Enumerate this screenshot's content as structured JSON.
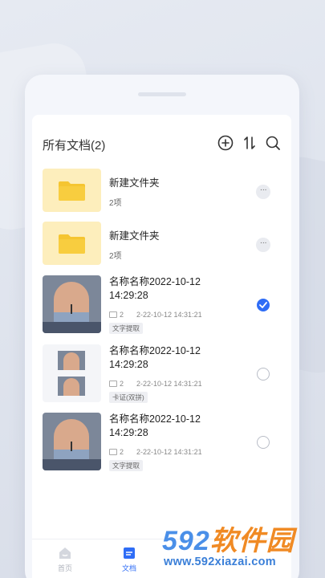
{
  "header": {
    "title": "所有文档(2)",
    "icons": [
      "add-circle-icon",
      "sort-icon",
      "search-icon"
    ]
  },
  "items": [
    {
      "type": "folder",
      "title": "新建文件夹",
      "subtitle": "2项",
      "action": "more"
    },
    {
      "type": "folder",
      "title": "新建文件夹",
      "subtitle": "2项",
      "action": "more"
    },
    {
      "type": "document",
      "title": "名称名称2022-10-12 14:29:28",
      "count": "2",
      "date": "2-22-10-12  14:31:21",
      "tag": "文字提取",
      "selected": true
    },
    {
      "type": "document",
      "title": "名称名称2022-10-12 14:29:28",
      "count": "2",
      "date": "2-22-10-12  14:31:21",
      "tag": "卡证(双拼)",
      "selected": false
    },
    {
      "type": "document",
      "title": "名称名称2022-10-12 14:29:28",
      "count": "2",
      "date": "2-22-10-12  14:31:21",
      "tag": "文字提取",
      "selected": false
    }
  ],
  "more_label": "···",
  "bottom_nav": [
    {
      "label": "首页",
      "icon": "home-icon",
      "active": false
    },
    {
      "label": "文档",
      "icon": "document-icon",
      "active": true
    }
  ],
  "watermark": {
    "brand_num": "592",
    "brand_text": "软件园",
    "url": "www.592xiazai.com"
  },
  "colors": {
    "accent": "#2f6df6",
    "folder_bg": "#fdeebc",
    "folder": "#f5c531"
  }
}
